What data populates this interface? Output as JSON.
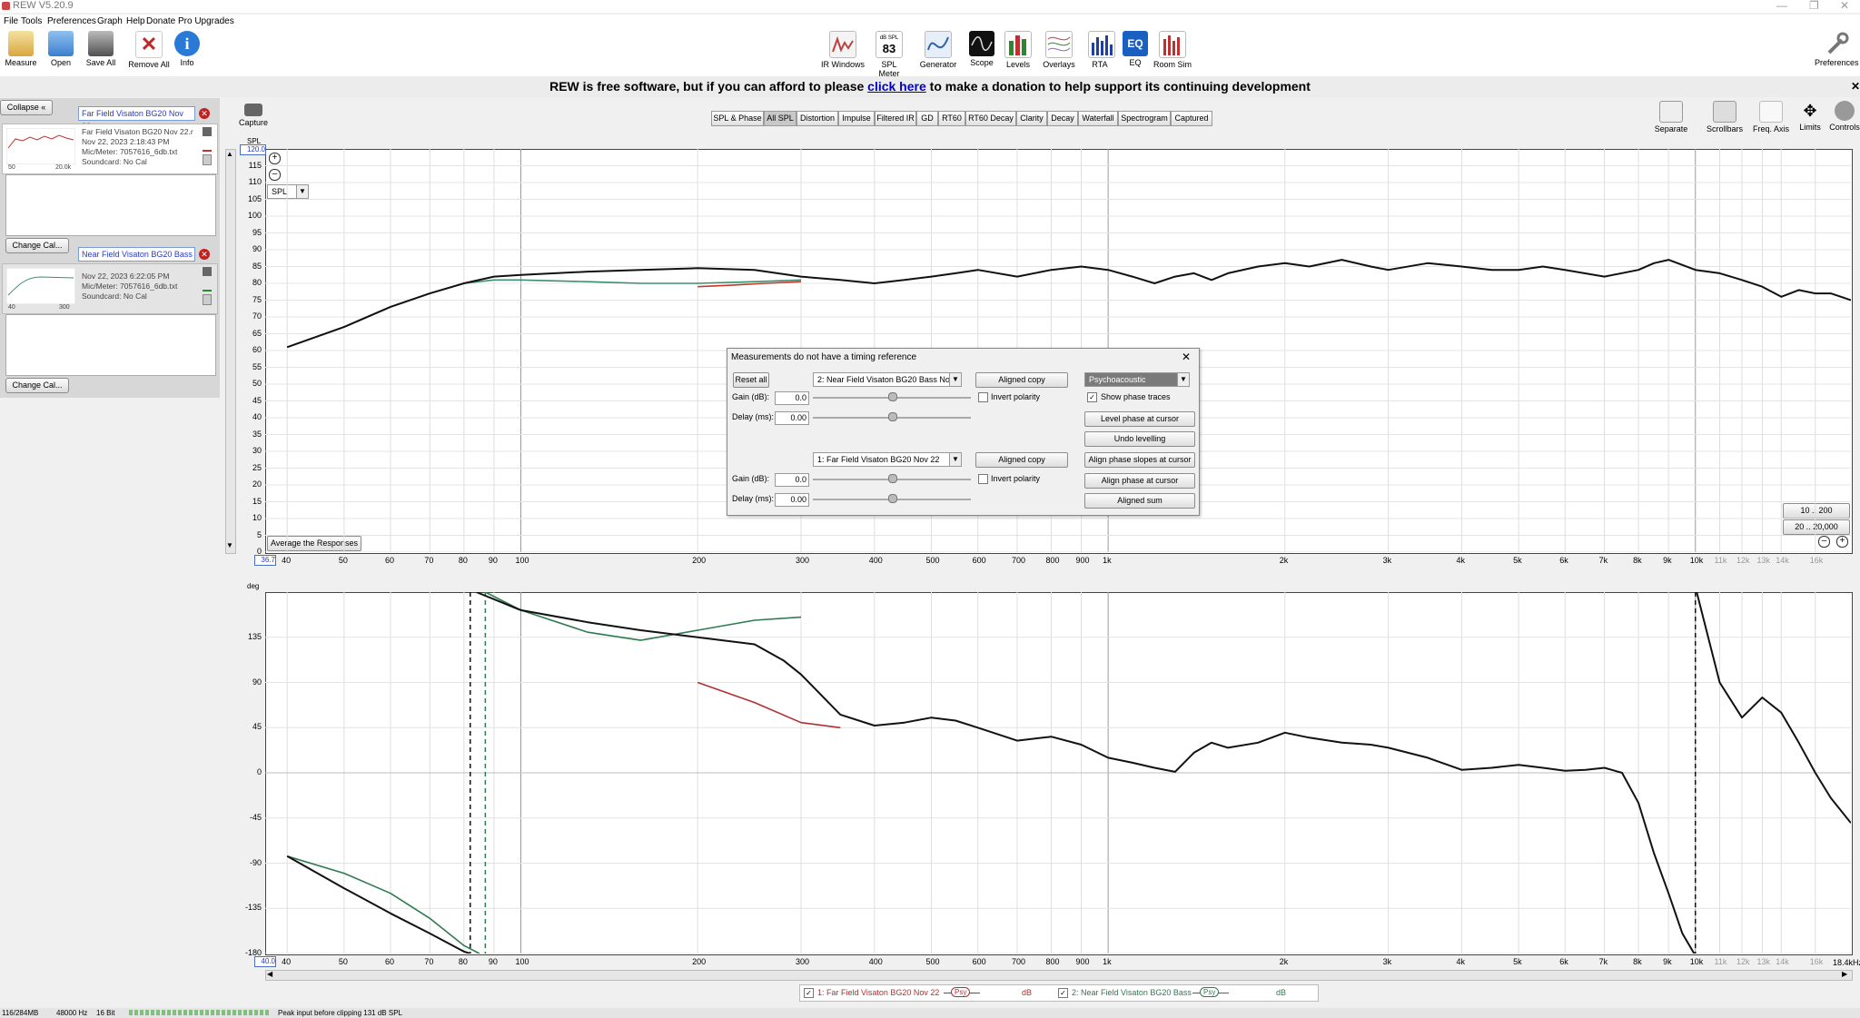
{
  "window": {
    "title": "REW V5.20.9"
  },
  "menu": [
    "File",
    "Tools",
    "Preferences",
    "Graph",
    "Help",
    "Donate",
    "Pro Upgrades"
  ],
  "toolbar": {
    "left": [
      {
        "label": "Measure",
        "icon": "measure-icon",
        "color": "#d9a640"
      },
      {
        "label": "Open",
        "icon": "open-icon",
        "color": "#3b7fd0"
      },
      {
        "label": "Save All",
        "icon": "save-icon",
        "color": "#505050"
      },
      {
        "label": "Remove All",
        "icon": "remove-icon",
        "color": "#c02828"
      },
      {
        "label": "Info",
        "icon": "info-icon",
        "color": "#2a79d6"
      }
    ],
    "center": [
      {
        "label": "IR Windows",
        "icon": "ir-windows-icon",
        "color": "#c04040"
      },
      {
        "label": "SPL Meter",
        "icon": "spl-meter-icon",
        "color": "#444",
        "text": "83",
        "sub": "dB SPL"
      },
      {
        "label": "Generator",
        "icon": "generator-icon",
        "color": "#2c5fb0"
      },
      {
        "label": "Scope",
        "icon": "scope-icon",
        "color": "#111"
      },
      {
        "label": "Levels",
        "icon": "levels-icon",
        "color": "#2a8a2a"
      },
      {
        "label": "Overlays",
        "icon": "overlays-icon",
        "color": "#7f6fc0"
      },
      {
        "label": "RTA",
        "icon": "rta-icon",
        "color": "#2040a0"
      },
      {
        "label": "EQ",
        "icon": "eq-icon",
        "color": "#1a60c0",
        "text": "EQ"
      },
      {
        "label": "Room Sim",
        "icon": "room-sim-icon",
        "color": "#c03030"
      }
    ],
    "right": {
      "label": "Preferences",
      "icon": "preferences-icon"
    }
  },
  "donate": {
    "before": "REW is free software, but if you can afford to please ",
    "link": "click here",
    "after": " to make a donation to help support its continuing development"
  },
  "left_panel": {
    "collapse": "Collapse",
    "measurements": [
      {
        "index": "1.",
        "name": "Far Field Visaton BG20 Nov 22",
        "line1": "Far Field Visaton BG20 Nov 22.r",
        "line2": "Nov 22, 2023 2:18:43 PM",
        "line3": "Mic/Meter: 7057616_6db.txt",
        "line4": "Soundcard: No Cal",
        "thumb_left": "50",
        "thumb_right": "20.0k",
        "change_cal": "Change Cal..."
      },
      {
        "index": "2.",
        "name": "Near Field Visaton BG20 Bass",
        "line1": "",
        "line2": "Nov 22, 2023 6:22:05 PM",
        "line3": "Mic/Meter: 7057616_6db.txt",
        "line4": "Soundcard: No Cal",
        "thumb_left": "40",
        "thumb_right": "300",
        "change_cal": "Change Cal..."
      }
    ]
  },
  "capture": "Capture",
  "tabs": [
    "SPL & Phase",
    "All SPL",
    "Distortion",
    "Impulse",
    "Filtered IR",
    "GD",
    "RT60",
    "RT60 Decay",
    "Clarity",
    "Decay",
    "Waterfall",
    "Spectrogram",
    "Captured"
  ],
  "selected_tab": "All SPL",
  "right_tools": [
    {
      "label": "Separate"
    },
    {
      "label": "Scrollbars"
    },
    {
      "label": "Freq. Axis"
    },
    {
      "label": "Limits"
    },
    {
      "label": "Controls"
    }
  ],
  "spl_graph": {
    "unit": "SPL",
    "ymax_box": "120.0",
    "ymin_box": "36.7",
    "selector": "SPL",
    "y_ticks": [
      "115",
      "110",
      "105",
      "100",
      "95",
      "90",
      "85",
      "80",
      "75",
      "70",
      "65",
      "60",
      "55",
      "50",
      "45",
      "40",
      "35",
      "30",
      "25",
      "20",
      "15",
      "10",
      "5",
      "0"
    ],
    "average_button": "Average the Responses",
    "range_buttons": [
      "10 .. 200",
      "20 .. 20,000"
    ]
  },
  "x_ticks": [
    {
      "f": 40,
      "t": "40",
      "minor": false
    },
    {
      "f": 50,
      "t": "50",
      "minor": false
    },
    {
      "f": 60,
      "t": "60",
      "minor": false
    },
    {
      "f": 70,
      "t": "70",
      "minor": false
    },
    {
      "f": 80,
      "t": "80",
      "minor": false
    },
    {
      "f": 90,
      "t": "90",
      "minor": false
    },
    {
      "f": 100,
      "t": "100",
      "minor": false
    },
    {
      "f": 200,
      "t": "200",
      "minor": false
    },
    {
      "f": 300,
      "t": "300",
      "minor": false
    },
    {
      "f": 400,
      "t": "400",
      "minor": false
    },
    {
      "f": 500,
      "t": "500",
      "minor": false
    },
    {
      "f": 600,
      "t": "600",
      "minor": false
    },
    {
      "f": 700,
      "t": "700",
      "minor": false
    },
    {
      "f": 800,
      "t": "800",
      "minor": false
    },
    {
      "f": 900,
      "t": "900",
      "minor": false
    },
    {
      "f": 1000,
      "t": "1k",
      "minor": false
    },
    {
      "f": 2000,
      "t": "2k",
      "minor": false
    },
    {
      "f": 3000,
      "t": "3k",
      "minor": false
    },
    {
      "f": 4000,
      "t": "4k",
      "minor": false
    },
    {
      "f": 5000,
      "t": "5k",
      "minor": false
    },
    {
      "f": 6000,
      "t": "6k",
      "minor": false
    },
    {
      "f": 7000,
      "t": "7k",
      "minor": false
    },
    {
      "f": 8000,
      "t": "8k",
      "minor": false
    },
    {
      "f": 9000,
      "t": "9k",
      "minor": false
    },
    {
      "f": 10000,
      "t": "10k",
      "minor": false
    },
    {
      "f": 11000,
      "t": "11k",
      "minor": true
    },
    {
      "f": 12000,
      "t": "12k",
      "minor": true
    },
    {
      "f": 13000,
      "t": "13k",
      "minor": true
    },
    {
      "f": 14000,
      "t": "14k",
      "minor": true
    },
    {
      "f": 16000,
      "t": "16k",
      "minor": true
    }
  ],
  "phase_graph": {
    "unit": "deg",
    "y_ticks": [
      "135",
      "90",
      "45",
      "0",
      "-45",
      "-90",
      "-135",
      "-180"
    ],
    "xmin_box": "40.0",
    "xmax_label": "18.4kHz"
  },
  "dialog": {
    "title": "Measurements do not have a timing reference",
    "reset": "Reset all",
    "combo1": "2: Near Field Visaton BG20 Bass No...",
    "combo2": "1: Far Field Visaton BG20 Nov 22",
    "aligned_copy": "Aligned copy",
    "gain_label": "Gain (dB):",
    "delay_label": "Delay (ms):",
    "gain1": "0.0",
    "delay1": "0.00",
    "gain2": "0.0",
    "delay2": "0.00",
    "invert": "Invert polarity",
    "mode": "Psychoacoustic",
    "show_phase": "Show phase traces",
    "level_phase": "Level phase at cursor",
    "undo": "Undo levelling",
    "align_slopes": "Align phase slopes at cursor",
    "align_phase": "Align phase at cursor",
    "aligned_sum": "Aligned sum"
  },
  "legend": {
    "m1": "1: Far Field Visaton BG20 Nov 22",
    "m2": "2: Near Field Visaton BG20 Bass",
    "psy": "Psy",
    "db": "dB"
  },
  "status": {
    "mem": "116/284MB",
    "rate": "48000 Hz",
    "bits": "16 Bit",
    "msg": "Peak input before clipping 131 dB SPL"
  },
  "chart_data": [
    {
      "type": "line",
      "title": "",
      "xlabel": "",
      "ylabel": "SPL",
      "x_scale": "log",
      "xlim": [
        36.7,
        18400
      ],
      "ylim": [
        0,
        120
      ],
      "series": [
        {
          "name": "1: Far Field Visaton BG20 Nov 22",
          "color": "#c0392b",
          "x": [
            200,
            230,
            260,
            300
          ],
          "y": [
            79,
            79.5,
            80,
            80.5
          ]
        },
        {
          "name": "2: Near Field Visaton BG20 Bass",
          "color": "#3a8f6e",
          "x": [
            40,
            50,
            60,
            70,
            80,
            90,
            100,
            130,
            160,
            200,
            250,
            300
          ],
          "y": [
            61,
            67,
            73,
            77,
            80,
            81,
            81,
            80.5,
            80,
            80,
            80.5,
            81
          ]
        },
        {
          "name": "",
          "color": "#111111",
          "x": [
            40,
            50,
            60,
            70,
            80,
            90,
            100,
            130,
            160,
            200,
            250,
            300,
            350,
            400,
            450,
            500,
            550,
            600,
            700,
            800,
            900,
            1000,
            1100,
            1200,
            1300,
            1400,
            1500,
            1600,
            1800,
            2000,
            2200,
            2500,
            2800,
            3000,
            3500,
            4000,
            4500,
            5000,
            5500,
            6000,
            7000,
            8000,
            8500,
            9000,
            10000,
            11000,
            12000,
            13000,
            14000,
            15000,
            16000,
            17000,
            18400
          ],
          "y": [
            61,
            67,
            73,
            77,
            80,
            82,
            82.5,
            83.5,
            84,
            84.5,
            84,
            82,
            81,
            80,
            81,
            82,
            83,
            84,
            82,
            84,
            85,
            84,
            82,
            80,
            82,
            83,
            81,
            83,
            85,
            86,
            85,
            87,
            85,
            84,
            86,
            85,
            84,
            84,
            85,
            84,
            82,
            84,
            86,
            87,
            84,
            83,
            81,
            79,
            76,
            78,
            77,
            77,
            75
          ]
        }
      ]
    },
    {
      "type": "line",
      "title": "",
      "xlabel": "",
      "ylabel": "deg",
      "x_scale": "log",
      "xlim": [
        36.7,
        18400
      ],
      "ylim": [
        -180,
        180
      ],
      "series": [
        {
          "name": "1: Far Field Visaton BG20 Nov 22",
          "color": "#b03030",
          "x": [
            200,
            250,
            300,
            350
          ],
          "y": [
            90,
            70,
            50,
            45
          ]
        },
        {
          "name": "2: Near Field Visaton BG20 Bass",
          "color": "#2f7a50",
          "x": [
            40,
            50,
            60,
            70,
            80,
            85,
            87,
            100,
            130,
            160,
            200,
            250,
            300
          ],
          "y": [
            -83,
            -100,
            -120,
            -145,
            -172,
            -180,
            180,
            162,
            140,
            132,
            142,
            152,
            155
          ]
        },
        {
          "name": "",
          "color": "#111111",
          "x": [
            40,
            50,
            60,
            70,
            80,
            82,
            84,
            100,
            130,
            160,
            200,
            250,
            280,
            300,
            350,
            400,
            450,
            500,
            550,
            600,
            700,
            800,
            900,
            1000,
            1100,
            1200,
            1300,
            1400,
            1500,
            1600,
            1800,
            2000,
            2200,
            2500,
            2800,
            3000,
            3500,
            4000,
            4500,
            5000,
            5500,
            6000,
            6500,
            7000,
            7500,
            8000,
            8500,
            9000,
            9500,
            9950,
            10050,
            11000,
            12000,
            13000,
            14000,
            15000,
            16000,
            17000,
            18400
          ],
          "y": [
            -83,
            -115,
            -140,
            -160,
            -178,
            -180,
            180,
            162,
            150,
            142,
            135,
            128,
            112,
            98,
            58,
            47,
            50,
            55,
            52,
            45,
            32,
            36,
            28,
            15,
            10,
            5,
            1,
            20,
            30,
            25,
            30,
            40,
            35,
            30,
            28,
            25,
            15,
            3,
            5,
            8,
            5,
            2,
            3,
            5,
            0,
            -30,
            -80,
            -120,
            -160,
            -180,
            180,
            90,
            55,
            75,
            60,
            30,
            0,
            -25,
            -50
          ]
        }
      ]
    }
  ]
}
